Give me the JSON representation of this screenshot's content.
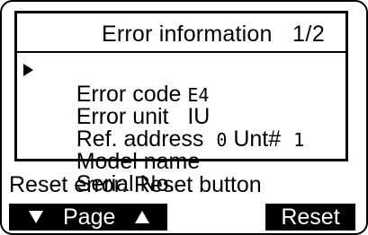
{
  "header": {
    "title": "Error information",
    "page": "1/2"
  },
  "fields": [
    {
      "label": "Error code",
      "value": "E4"
    },
    {
      "label": "Error unit",
      "value": "IU"
    },
    {
      "label": "Ref. address",
      "value": "0",
      "extra_label": "Unt#",
      "extra_value": "1"
    },
    {
      "label": "Model name",
      "value": ""
    },
    {
      "label": "Serial No.",
      "value": ""
    }
  ],
  "footer": {
    "instruction": "Reset error: Reset button",
    "page_button": "Page",
    "reset_button": "Reset"
  },
  "icons": {
    "cursor": "selection-arrow-icon",
    "page_down": "triangle-down-icon",
    "page_up": "triangle-up-icon"
  }
}
